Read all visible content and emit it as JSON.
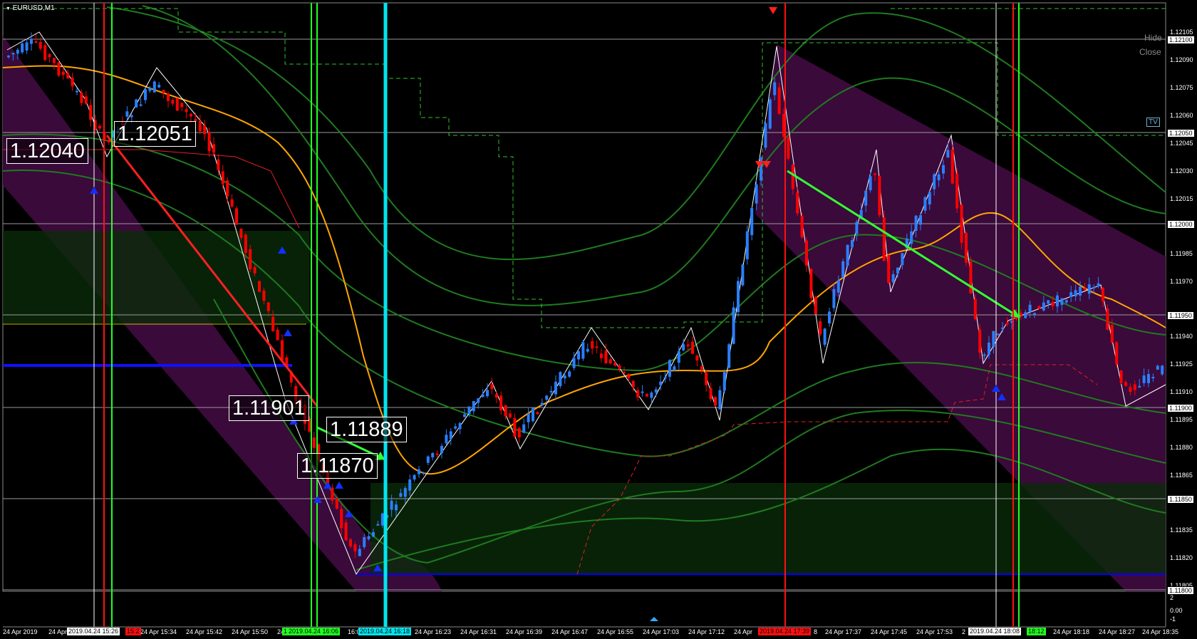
{
  "window": {
    "title": "EURUSD,M1"
  },
  "controls": {
    "hide": "Hide",
    "close": "Close",
    "tv": "TV"
  },
  "colors": {
    "background": "#000000",
    "bull": "#2a7fff",
    "bear": "#ff0000",
    "envelope": "#3a0a3a",
    "bands": "#1f7a1f",
    "ma": "#ffa500",
    "trend_down": "#ff2020",
    "trend_green": "#33ff33",
    "hline_blue": "#0000ff",
    "vline_cyan": "#00e5ee"
  },
  "price_axis": {
    "ticks": [
      "1.12105",
      "1.12090",
      "1.12075",
      "1.12060",
      "1.12045",
      "1.12030",
      "1.12015",
      "1.11985",
      "1.11970",
      "1.11940",
      "1.11925",
      "1.11910",
      "1.11895",
      "1.11880",
      "1.11865",
      "1.11835",
      "1.11820",
      "1.11805"
    ],
    "levels": [
      "1.12100",
      "1.12050",
      "1.12000",
      "1.11950",
      "1.11900",
      "1.11850",
      "1.11800"
    ]
  },
  "level_labels": [
    "1.12040",
    "1.12051",
    "1.11901",
    "1.11889",
    "1.11870"
  ],
  "indicator": {
    "ticks": [
      "2",
      "0.00",
      "-1"
    ]
  },
  "time_axis": [
    "24 Apr 2019",
    "24 Apr",
    "24 Apr 15:34",
    "24 Apr 15:42",
    "24 Apr 15:50",
    "24",
    "16:0",
    "24 Apr 16:23",
    "24 Apr 16:31",
    "24 Apr 16:39",
    "24 Apr 16:47",
    "24 Apr 16:55",
    "24 Apr 17:03",
    "24 Apr 17:12",
    "24 Apr",
    "8",
    "24 Apr 17:37",
    "24 Apr 17:45",
    "24 Apr 17:53",
    "2",
    "24 Apr 18:18",
    "24 Apr 18:27",
    "24 Apr 18:35"
  ],
  "vline_tags": [
    {
      "date": "2019.04.24 15:26",
      "time": "15:2"
    },
    {
      "date": "2019.04.24 16:06",
      "time": "1"
    },
    {
      "date": "2019.04.24 16:18",
      "time": ""
    },
    {
      "date": "2019.04.24 17:39",
      "time": ""
    },
    {
      "date": "2019.04.24 18:08",
      "time": "18:12"
    }
  ]
}
